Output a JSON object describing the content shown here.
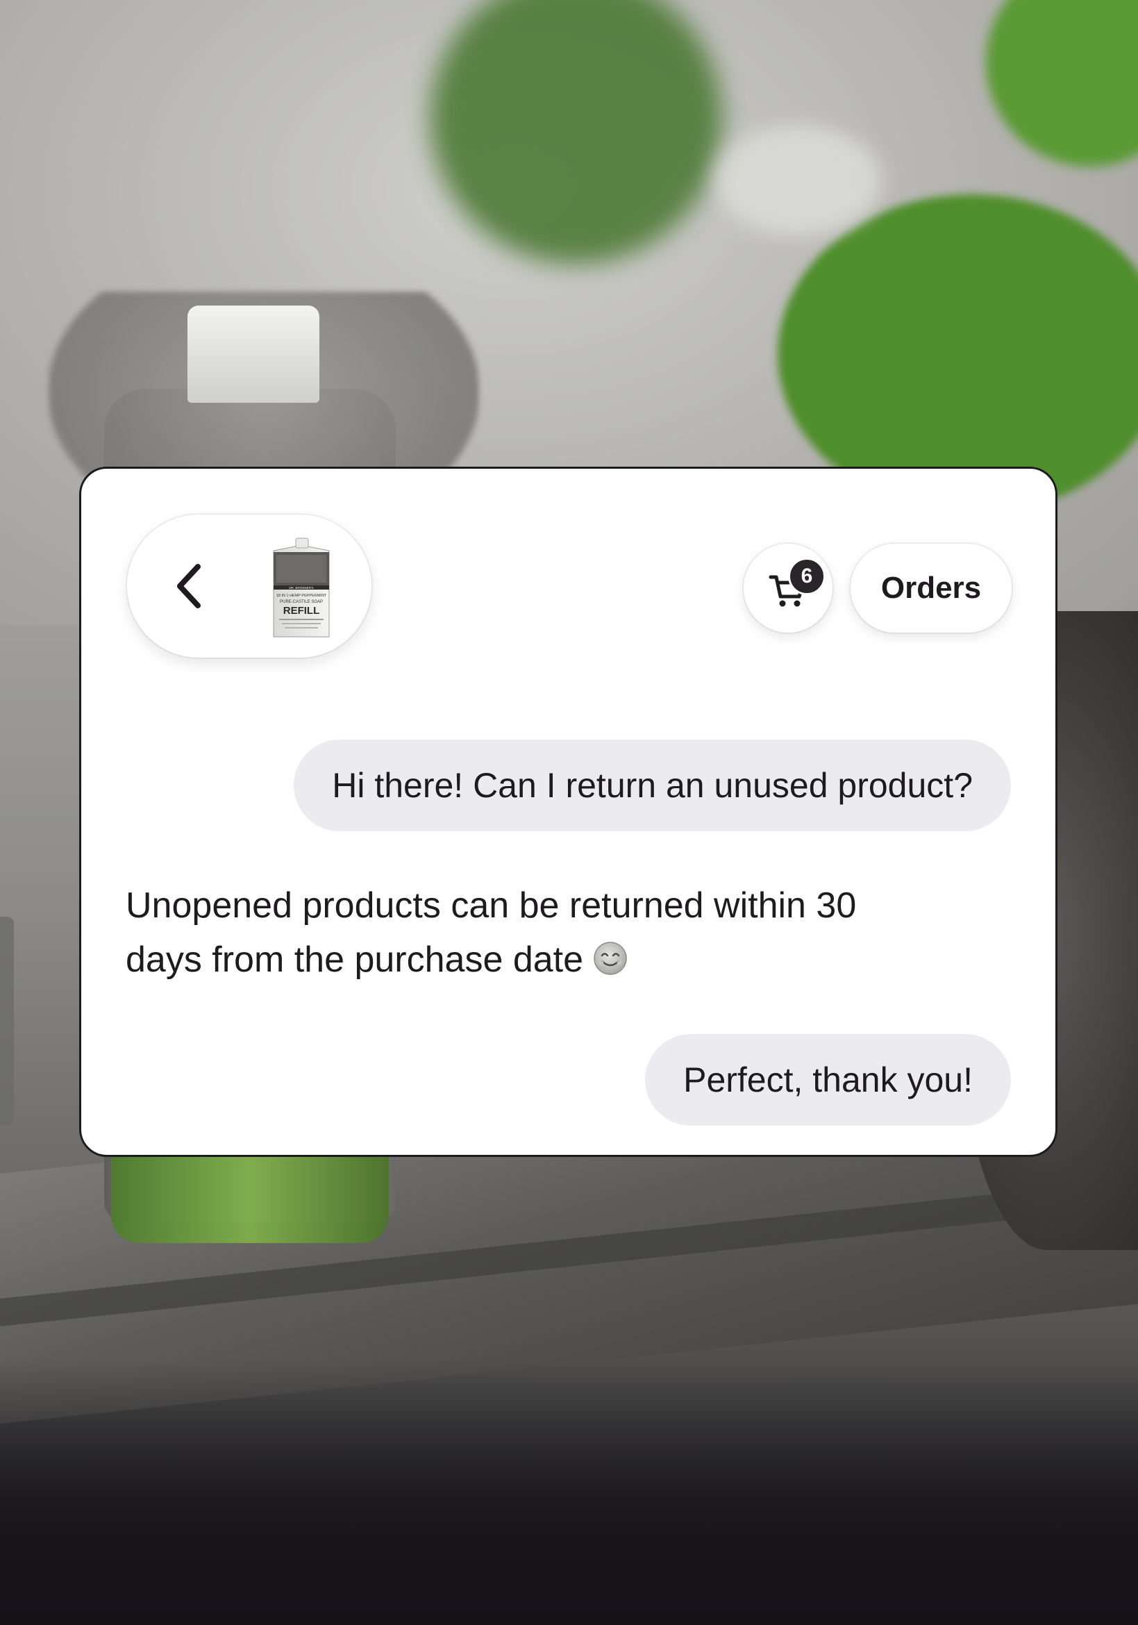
{
  "header": {
    "back_label": "Back",
    "product_thumb": {
      "brand": "DR. BRONNER'S",
      "line": "18 IN 1 HEMP PEPPERMINT",
      "subline": "PURE-CASTILE SOAP",
      "label": "REFILL"
    },
    "cart": {
      "count": "6"
    },
    "orders_label": "Orders"
  },
  "messages": [
    {
      "role": "user",
      "text": "Hi there! Can I return an unused product?"
    },
    {
      "role": "assistant",
      "lines": [
        "Unopened products can be returned within 30",
        "days from the purchase date"
      ],
      "emoji": "smiling-face-icon"
    },
    {
      "role": "user",
      "text": "Perfect, thank you!"
    }
  ],
  "colors": {
    "card_background": "#ffffff",
    "user_bubble": "#ececf0",
    "text": "#1d1b1e",
    "badge": "#2a2528",
    "leaf_green": "#4f8e2c"
  }
}
